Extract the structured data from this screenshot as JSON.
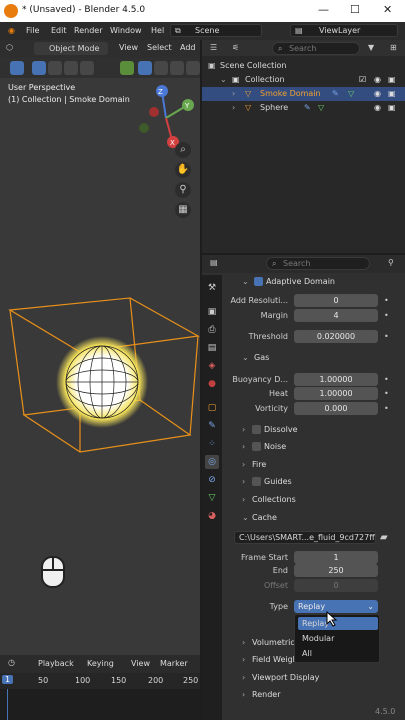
{
  "window": {
    "title": "* (Unsaved) - Blender 4.5.0",
    "min": "—",
    "max": "☐",
    "close": "✕"
  },
  "menubar": {
    "items": [
      "File",
      "Edit",
      "Render",
      "Window",
      "Hel"
    ],
    "scene": "Scene",
    "view_layer": "ViewLayer"
  },
  "viewport": {
    "mode": "Object Mode",
    "menus": [
      "View",
      "Select",
      "Add"
    ],
    "perspective": "User Perspective",
    "context": "(1) Collection | Smoke Domain",
    "axes": [
      "Z",
      "Y",
      "X"
    ]
  },
  "timeline": {
    "menus": [
      "Playback",
      "Keying",
      "View",
      "Marker"
    ],
    "current_frame": "1",
    "ticks": [
      "50",
      "100",
      "150",
      "200",
      "250"
    ]
  },
  "outliner": {
    "search_placeholder": "Search",
    "root": "Scene Collection",
    "collection": "Collection",
    "items": [
      {
        "label": "Smoke Domain",
        "selected": true
      },
      {
        "label": "Sphere",
        "selected": false
      }
    ]
  },
  "properties": {
    "search_placeholder": "Search",
    "adaptive_domain": {
      "label": "Adaptive Domain",
      "checked": true
    },
    "fields": [
      {
        "label": "Add Resoluti...",
        "value": "0"
      },
      {
        "label": "Margin",
        "value": "4"
      },
      {
        "label": "Threshold",
        "value": "0.020000"
      }
    ],
    "gas": {
      "label": "Gas",
      "fields": [
        {
          "label": "Buoyancy D...",
          "value": "1.00000"
        },
        {
          "label": "Heat",
          "value": "1.00000"
        },
        {
          "label": "Vorticity",
          "value": "0.000"
        }
      ]
    },
    "sections": [
      "Dissolve",
      "Noise",
      "Fire",
      "Guides",
      "Collections"
    ],
    "cache": {
      "label": "Cache",
      "path": "C:\\Users\\SMART...e_fluid_9cd727ff",
      "frame_start_label": "Frame Start",
      "frame_start": "1",
      "end_label": "End",
      "end": "250",
      "offset_label": "Offset",
      "offset": "0",
      "type_label": "Type",
      "type_value": "Replay",
      "type_options": [
        "Replay",
        "Modular",
        "All"
      ]
    },
    "lower_sections": [
      "Volumetric",
      "Field Weigh...",
      "Viewport Display",
      "Render"
    ]
  },
  "version": "4.5.0"
}
